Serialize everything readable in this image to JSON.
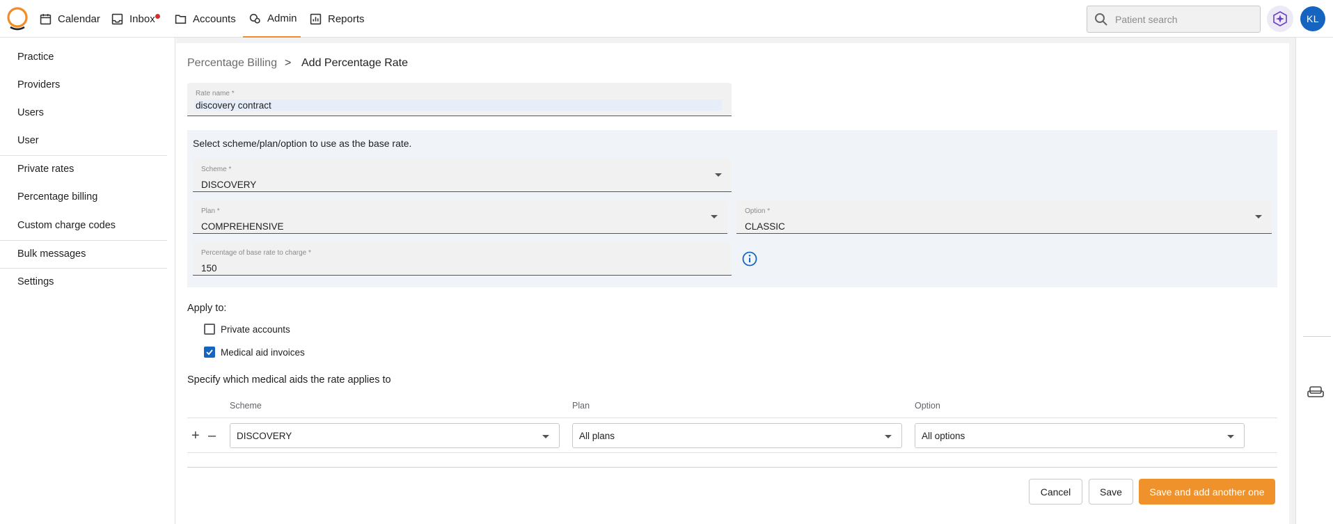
{
  "nav": {
    "items": [
      {
        "label": "Calendar",
        "icon": "calendar-icon"
      },
      {
        "label": "Inbox",
        "icon": "inbox-icon",
        "has_unread": true
      },
      {
        "label": "Accounts",
        "icon": "folder-icon"
      },
      {
        "label": "Admin",
        "icon": "admin-icon",
        "active": true
      },
      {
        "label": "Reports",
        "icon": "reports-icon"
      }
    ],
    "search_placeholder": "Patient search",
    "user_initials": "KL",
    "accent_color": "#f28c28"
  },
  "sidebar": {
    "items": [
      {
        "label": "Practice"
      },
      {
        "label": "Providers"
      },
      {
        "label": "Users"
      },
      {
        "label": "User"
      },
      {
        "label": "Private rates"
      },
      {
        "label": "Percentage billing"
      },
      {
        "label": "Custom charge codes"
      },
      {
        "label": "Bulk messages"
      },
      {
        "label": "Settings"
      }
    ]
  },
  "breadcrumb": {
    "parent": "Percentage Billing",
    "separator": ">",
    "current": "Add Percentage Rate"
  },
  "form": {
    "rate_name": {
      "label": "Rate name *",
      "value": "discovery contract"
    },
    "base_rate_title": "Select scheme/plan/option to use as the base rate.",
    "scheme": {
      "label": "Scheme *",
      "value": "DISCOVERY"
    },
    "plan": {
      "label": "Plan *",
      "value": "COMPREHENSIVE"
    },
    "option": {
      "label": "Option *",
      "value": "CLASSIC"
    },
    "percentage": {
      "label": "Percentage of base rate to charge *",
      "value": "150"
    },
    "apply_to_label": "Apply to:",
    "apply_private": {
      "label": "Private accounts",
      "checked": false
    },
    "apply_medical": {
      "label": "Medical aid invoices",
      "checked": true
    },
    "specify_label": "Specify which medical aids the rate applies to",
    "table": {
      "headers": [
        "Scheme",
        "Plan",
        "Option"
      ],
      "rows": [
        {
          "scheme": "DISCOVERY",
          "plan": "All plans",
          "option": "All options"
        }
      ]
    }
  },
  "actions": {
    "cancel": "Cancel",
    "save": "Save",
    "save_add": "Save and add another one",
    "primary_color": "#f0922b"
  }
}
